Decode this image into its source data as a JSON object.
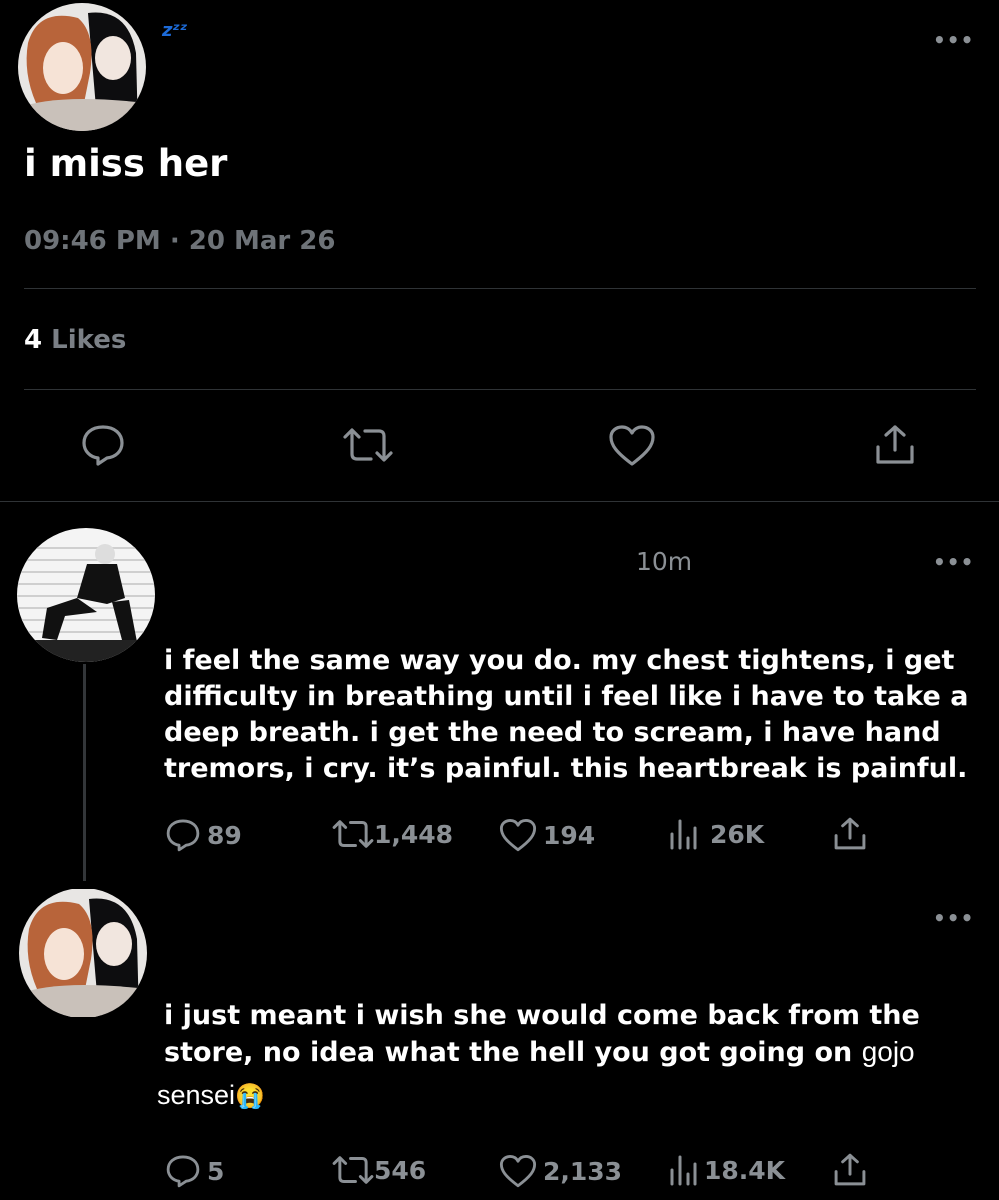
{
  "main_tweet": {
    "username_emoji": "zᶻᶻ",
    "text": "i miss her",
    "time": "09:46 PM",
    "separator": "·",
    "date": "20 Mar 26",
    "likes_count": "4",
    "likes_label": "Likes"
  },
  "reply1": {
    "time": "10m",
    "lines": [
      "i feel the same way you do. my chest tightens, i get",
      "difficulty in breathing until i feel like i have to take a",
      "deep breath. i get the need to scream, i have hand",
      "tremors, i cry. it’s painful. this heartbreak is painful."
    ],
    "replies": "89",
    "retweets": "1,448",
    "likes": "194",
    "views": "26K"
  },
  "reply2": {
    "lines": [
      "i just meant i wish she would come back from the",
      "store, no idea what the hell you got going on"
    ],
    "handwritten_1": "gojo",
    "handwritten_2": "sensei",
    "emoji": "😭",
    "replies": "5",
    "retweets": "546",
    "likes": "2,133",
    "views": "18.4K"
  },
  "icons": [
    "reply-icon",
    "retweet-icon",
    "like-icon",
    "share-icon",
    "views-icon",
    "more-icon"
  ],
  "colors": {
    "background": "#000000",
    "muted": "#71767b",
    "divider": "#2f3336",
    "zzz": "#1d6bd8"
  }
}
